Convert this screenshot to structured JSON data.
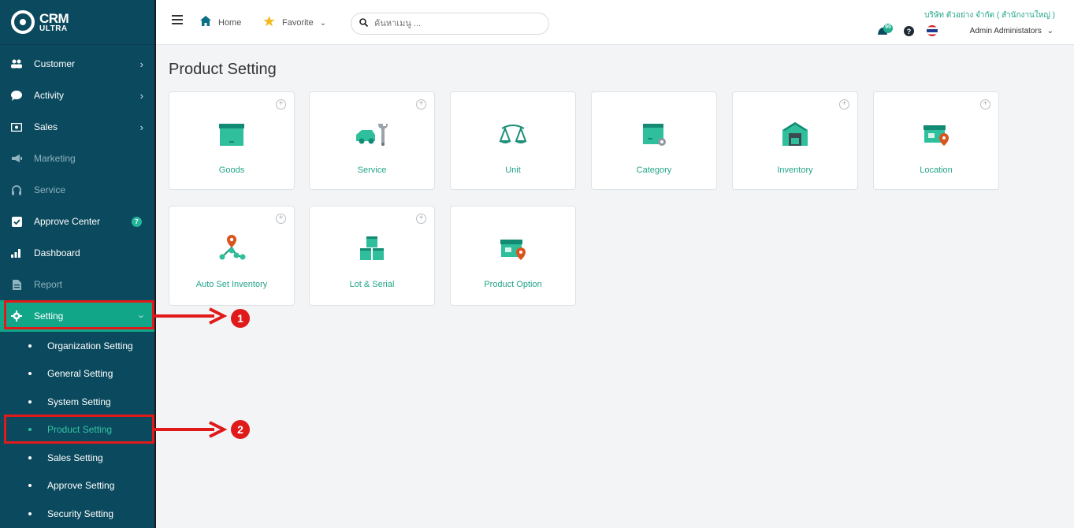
{
  "logo": {
    "line1": "CRM",
    "line2": "ULTRA"
  },
  "sidebar": {
    "items": [
      {
        "label": "Customer",
        "icon": "users-icon"
      },
      {
        "label": "Activity",
        "icon": "chat-icon"
      },
      {
        "label": "Sales",
        "icon": "money-icon"
      },
      {
        "label": "Marketing",
        "icon": "megaphone-icon"
      },
      {
        "label": "Service",
        "icon": "headset-icon"
      },
      {
        "label": "Approve Center",
        "icon": "check-square-icon",
        "badge": "7"
      },
      {
        "label": "Dashboard",
        "icon": "bar-chart-icon"
      },
      {
        "label": "Report",
        "icon": "file-icon"
      },
      {
        "label": "Setting",
        "icon": "gear-icon"
      }
    ],
    "sub_items": [
      "Organization Setting",
      "General Setting",
      "System Setting",
      "Product Setting",
      "Sales Setting",
      "Approve Setting",
      "Security Setting"
    ]
  },
  "topbar": {
    "home": "Home",
    "favorite": "Favorite",
    "search_placeholder": "ค้นหาเมนู ...",
    "company": "บริษัท ตัวอย่าง จำกัด ( สำนักงานใหญ่ )",
    "user": "Admin Administators",
    "notification_count": "95"
  },
  "page": {
    "title": "Product Setting",
    "cards": [
      "Goods",
      "Service",
      "Unit",
      "Category",
      "Inventory",
      "Location",
      "Auto Set Inventory",
      "Lot & Serial",
      "Product Option"
    ]
  },
  "annotations": {
    "one": "1",
    "two": "2"
  },
  "colors": {
    "sidebar": "#0b4a5e",
    "accent": "#12a689",
    "annotation": "#e01a1a"
  }
}
